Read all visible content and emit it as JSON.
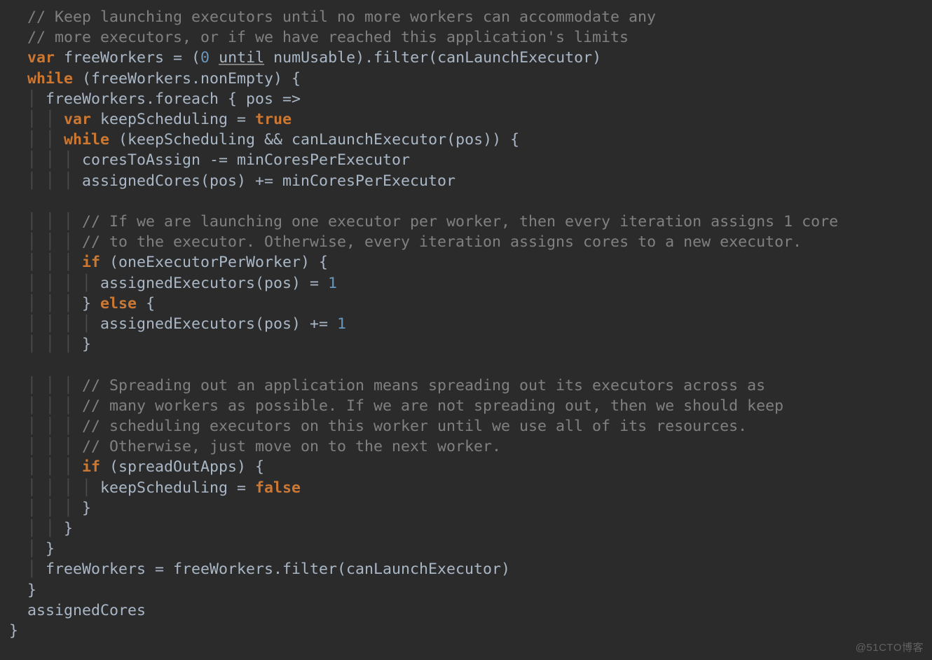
{
  "watermark": "@51CTO博客",
  "code": {
    "lines": [
      [
        {
          "t": "   ",
          "c": ""
        },
        {
          "t": "// Keep launching executors until no more workers can accommodate any",
          "c": "tok-comment"
        }
      ],
      [
        {
          "t": "   ",
          "c": ""
        },
        {
          "t": "// more executors, or if we have reached this application's limits",
          "c": "tok-comment"
        }
      ],
      [
        {
          "t": "   ",
          "c": ""
        },
        {
          "t": "var",
          "c": "tok-keyword"
        },
        {
          "t": " freeWorkers = (",
          "c": ""
        },
        {
          "t": "0",
          "c": "tok-number"
        },
        {
          "t": " ",
          "c": ""
        },
        {
          "t": "until",
          "c": "tok-underline"
        },
        {
          "t": " numUsable).filter(canLaunchExecutor)",
          "c": ""
        }
      ],
      [
        {
          "t": "   ",
          "c": ""
        },
        {
          "t": "while",
          "c": "tok-keyword"
        },
        {
          "t": " (freeWorkers.nonEmpty) {",
          "c": ""
        }
      ],
      [
        {
          "t": "   ",
          "c": ""
        },
        {
          "t": "│ ",
          "c": "tok-guide"
        },
        {
          "t": "freeWorkers.foreach { pos =>",
          "c": ""
        }
      ],
      [
        {
          "t": "   ",
          "c": ""
        },
        {
          "t": "│ │ ",
          "c": "tok-guide"
        },
        {
          "t": "var",
          "c": "tok-keyword"
        },
        {
          "t": " keepScheduling = ",
          "c": ""
        },
        {
          "t": "true",
          "c": "tok-keyword"
        }
      ],
      [
        {
          "t": "   ",
          "c": ""
        },
        {
          "t": "│ │ ",
          "c": "tok-guide"
        },
        {
          "t": "while",
          "c": "tok-keyword"
        },
        {
          "t": " (keepScheduling && canLaunchExecutor(pos)) {",
          "c": ""
        }
      ],
      [
        {
          "t": "   ",
          "c": ""
        },
        {
          "t": "│ │ │ ",
          "c": "tok-guide"
        },
        {
          "t": "coresToAssign -= minCoresPerExecutor",
          "c": ""
        }
      ],
      [
        {
          "t": "   ",
          "c": ""
        },
        {
          "t": "│ │ │ ",
          "c": "tok-guide"
        },
        {
          "t": "assignedCores(pos) += minCoresPerExecutor",
          "c": ""
        }
      ],
      [
        {
          "t": "",
          "c": ""
        }
      ],
      [
        {
          "t": "   ",
          "c": ""
        },
        {
          "t": "│ │ │ ",
          "c": "tok-guide"
        },
        {
          "t": "// If we are launching one executor per worker, then every iteration assigns 1 core",
          "c": "tok-comment"
        }
      ],
      [
        {
          "t": "   ",
          "c": ""
        },
        {
          "t": "│ │ │ ",
          "c": "tok-guide"
        },
        {
          "t": "// to the executor. Otherwise, every iteration assigns cores to a new executor.",
          "c": "tok-comment"
        }
      ],
      [
        {
          "t": "   ",
          "c": ""
        },
        {
          "t": "│ │ │ ",
          "c": "tok-guide"
        },
        {
          "t": "if",
          "c": "tok-keyword"
        },
        {
          "t": " (oneExecutorPerWorker) {",
          "c": ""
        }
      ],
      [
        {
          "t": "   ",
          "c": ""
        },
        {
          "t": "│ │ │ │ ",
          "c": "tok-guide"
        },
        {
          "t": "assignedExecutors(pos) = ",
          "c": ""
        },
        {
          "t": "1",
          "c": "tok-number"
        }
      ],
      [
        {
          "t": "   ",
          "c": ""
        },
        {
          "t": "│ │ │ ",
          "c": "tok-guide"
        },
        {
          "t": "} ",
          "c": ""
        },
        {
          "t": "else",
          "c": "tok-keyword"
        },
        {
          "t": " {",
          "c": ""
        }
      ],
      [
        {
          "t": "   ",
          "c": ""
        },
        {
          "t": "│ │ │ │ ",
          "c": "tok-guide"
        },
        {
          "t": "assignedExecutors(pos) += ",
          "c": ""
        },
        {
          "t": "1",
          "c": "tok-number"
        }
      ],
      [
        {
          "t": "   ",
          "c": ""
        },
        {
          "t": "│ │ │ ",
          "c": "tok-guide"
        },
        {
          "t": "}",
          "c": ""
        }
      ],
      [
        {
          "t": "",
          "c": ""
        }
      ],
      [
        {
          "t": "   ",
          "c": ""
        },
        {
          "t": "│ │ │ ",
          "c": "tok-guide"
        },
        {
          "t": "// Spreading out an application means spreading out its executors across as",
          "c": "tok-comment"
        }
      ],
      [
        {
          "t": "   ",
          "c": ""
        },
        {
          "t": "│ │ │ ",
          "c": "tok-guide"
        },
        {
          "t": "// many workers as possible. If we are not spreading out, then we should keep",
          "c": "tok-comment"
        }
      ],
      [
        {
          "t": "   ",
          "c": ""
        },
        {
          "t": "│ │ │ ",
          "c": "tok-guide"
        },
        {
          "t": "// scheduling executors on this worker until we use all of its resources.",
          "c": "tok-comment"
        }
      ],
      [
        {
          "t": "   ",
          "c": ""
        },
        {
          "t": "│ │ │ ",
          "c": "tok-guide"
        },
        {
          "t": "// Otherwise, just move on to the next worker.",
          "c": "tok-comment"
        }
      ],
      [
        {
          "t": "   ",
          "c": ""
        },
        {
          "t": "│ │ │ ",
          "c": "tok-guide"
        },
        {
          "t": "if",
          "c": "tok-keyword"
        },
        {
          "t": " (spreadOutApps) {",
          "c": ""
        }
      ],
      [
        {
          "t": "   ",
          "c": ""
        },
        {
          "t": "│ │ │ │ ",
          "c": "tok-guide"
        },
        {
          "t": "keepScheduling = ",
          "c": ""
        },
        {
          "t": "false",
          "c": "tok-keyword"
        }
      ],
      [
        {
          "t": "   ",
          "c": ""
        },
        {
          "t": "│ │ │ ",
          "c": "tok-guide"
        },
        {
          "t": "}",
          "c": ""
        }
      ],
      [
        {
          "t": "   ",
          "c": ""
        },
        {
          "t": "│ │ ",
          "c": "tok-guide"
        },
        {
          "t": "}",
          "c": ""
        }
      ],
      [
        {
          "t": "   ",
          "c": ""
        },
        {
          "t": "│ ",
          "c": "tok-guide"
        },
        {
          "t": "}",
          "c": ""
        }
      ],
      [
        {
          "t": "   ",
          "c": ""
        },
        {
          "t": "│ ",
          "c": "tok-guide"
        },
        {
          "t": "freeWorkers = freeWorkers.filter(canLaunchExecutor)",
          "c": ""
        }
      ],
      [
        {
          "t": "   ",
          "c": ""
        },
        {
          "t": "}",
          "c": ""
        }
      ],
      [
        {
          "t": "   ",
          "c": ""
        },
        {
          "t": "assignedCores",
          "c": ""
        }
      ],
      [
        {
          "t": " ",
          "c": ""
        },
        {
          "t": "}",
          "c": ""
        }
      ]
    ]
  }
}
